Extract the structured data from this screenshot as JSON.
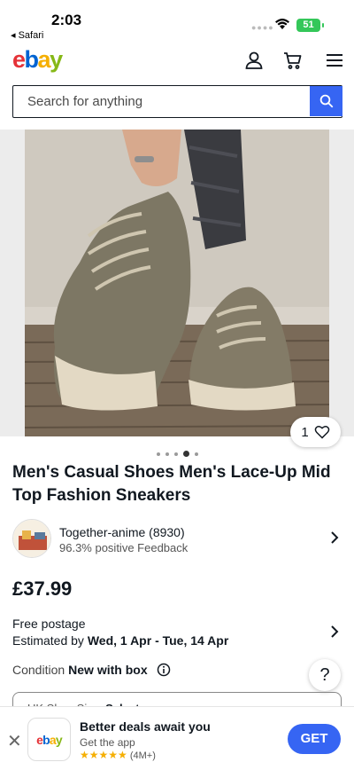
{
  "status_bar": {
    "time": "2:03",
    "back_app": "◂ Safari",
    "battery": "51"
  },
  "header": {
    "logo": {
      "e": "e",
      "b": "b",
      "a": "a",
      "y": "y"
    }
  },
  "search": {
    "placeholder": "Search for anything"
  },
  "gallery": {
    "image_count": 5,
    "active_index": 3,
    "watch_count": "1"
  },
  "product": {
    "title": "Men's Casual Shoes Men's Lace-Up Mid Top Fashion Sneakers",
    "price": "£37.99",
    "postage": "Free postage",
    "delivery_prefix": "Estimated by ",
    "delivery_dates": "Wed, 1 Apr - Tue, 14 Apr",
    "condition_label": "Condition ",
    "condition_value": "New with box",
    "size_label": "UK Shoe Size: ",
    "size_value": "Select"
  },
  "seller": {
    "name": "Together-anime (8930)",
    "feedback": "96.3% positive Feedback"
  },
  "help": {
    "label": "?"
  },
  "app_banner": {
    "close": "✕",
    "logo": "ebay",
    "title": "Better deals await you",
    "subtitle": "Get the app",
    "stars": "★★★★★",
    "reviews": "(4M+)",
    "cta": "GET"
  },
  "colors": {
    "accent": "#3665f3",
    "logo_e": "#e53238",
    "logo_b": "#0064d2",
    "logo_a": "#f5af02",
    "logo_y": "#86b817"
  }
}
